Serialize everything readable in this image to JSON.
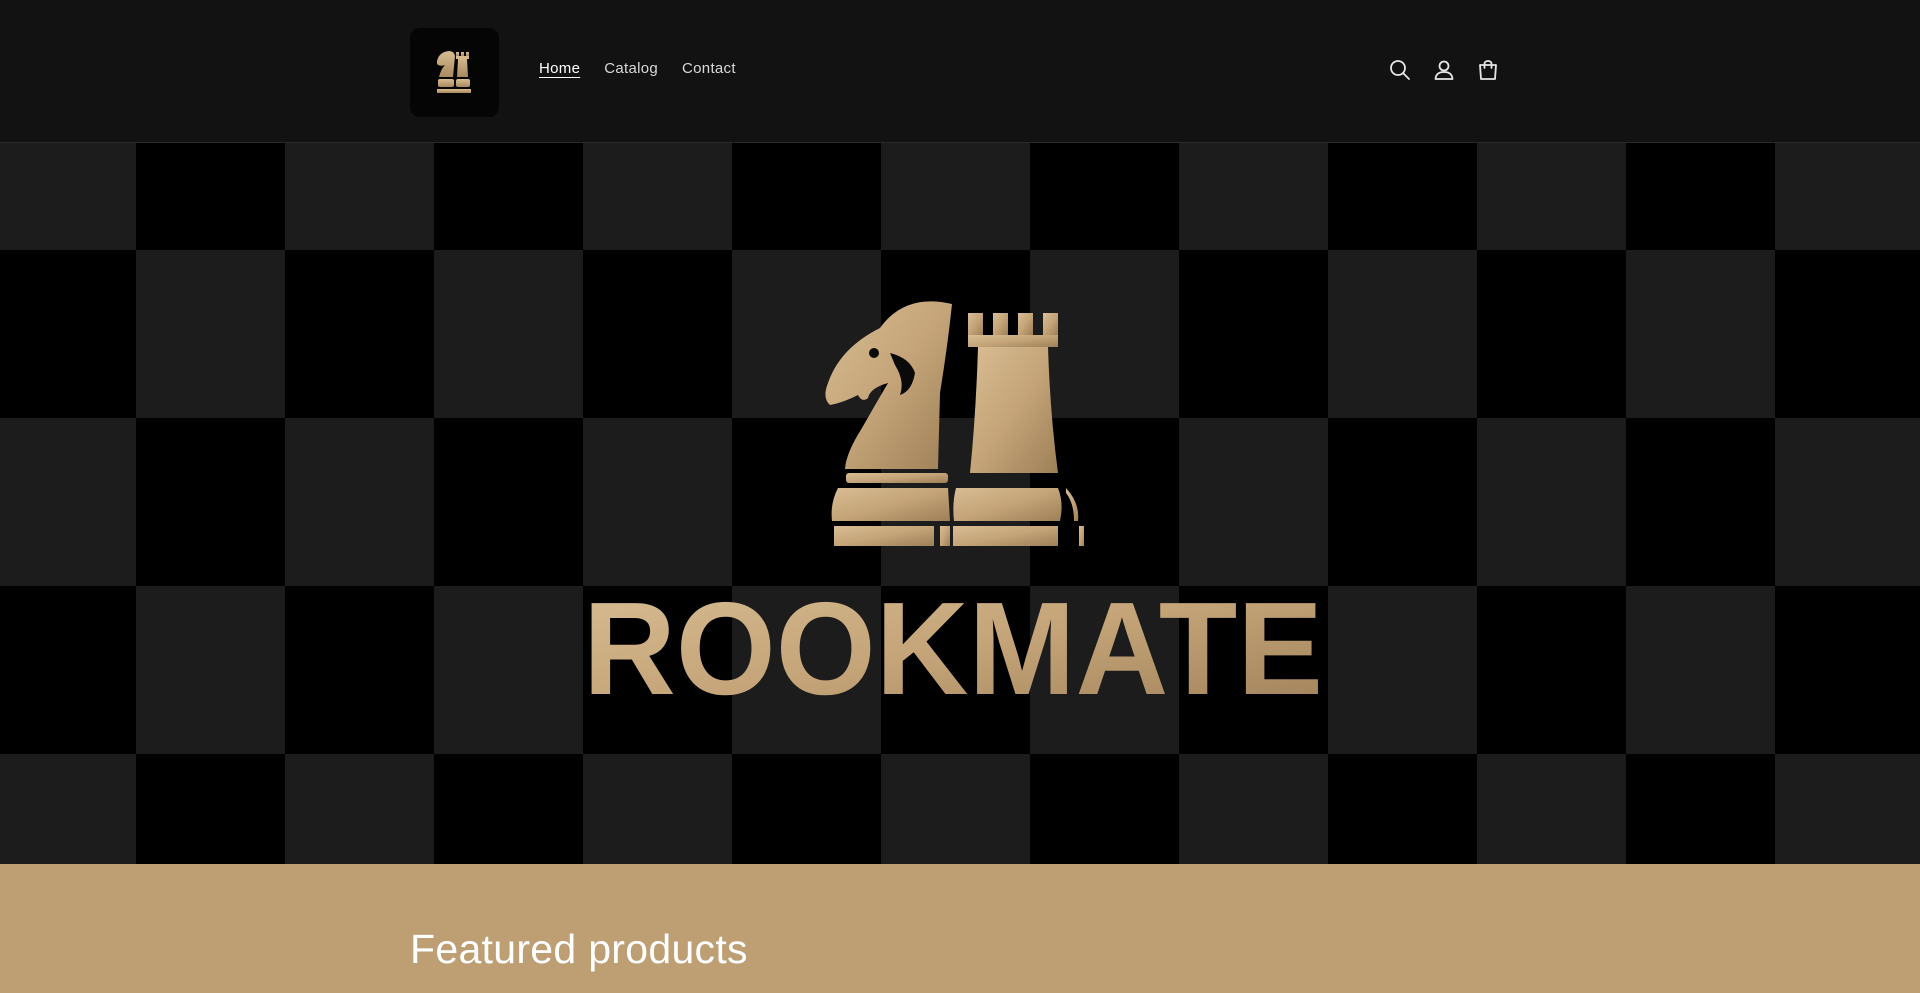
{
  "header": {
    "logo_icon": "rookmate-logo-icon",
    "nav": [
      {
        "label": "Home",
        "active": true
      },
      {
        "label": "Catalog",
        "active": false
      },
      {
        "label": "Contact",
        "active": false
      }
    ],
    "icons": [
      "search-icon",
      "account-icon",
      "cart-icon"
    ]
  },
  "hero": {
    "brand_name": "ROOKMATE",
    "colors": {
      "gold": "#c9a878",
      "dark_square": "#1c1c1c",
      "black_square": "#000000"
    }
  },
  "featured": {
    "title": "Featured products",
    "background": "#be9e73"
  }
}
